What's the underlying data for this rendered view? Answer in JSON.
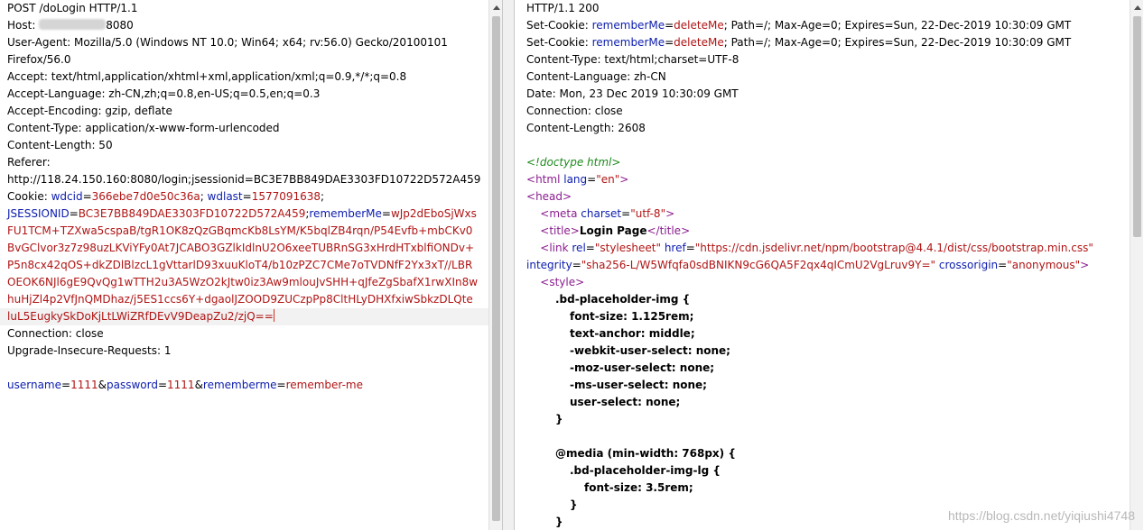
{
  "request": {
    "line1": "POST /doLogin HTTP/1.1",
    "host_label": "Host: ",
    "host_port": "8080",
    "ua1": "User-Agent: Mozilla/5.0 (Windows NT 10.0; Win64; x64; rv:56.0) Gecko/20100101",
    "ua2": "Firefox/56.0",
    "accept": "Accept: text/html,application/xhtml+xml,application/xml;q=0.9,*/*;q=0.8",
    "accept_language": "Accept-Language: zh-CN,zh;q=0.8,en-US;q=0.5,en;q=0.3",
    "accept_encoding": "Accept-Encoding: gzip, deflate",
    "content_type": "Content-Type: application/x-www-form-urlencoded",
    "content_length": "Content-Length: 50",
    "referer_label": "Referer:",
    "referer_url": "http://118.24.150.160:8080/login;jsessionid=BC3E7BB849DAE3303FD10722D572A459",
    "cookie_label": "Cookie: ",
    "cookie_k1": "wdcid",
    "cookie_v1": "366ebe7d0e50c36a",
    "cookie_k2": "wdlast",
    "cookie_v2": "1577091638",
    "cookie_k3": "JSESSIONID",
    "cookie_v3": "BC3E7BB849DAE3303FD10722D572A459",
    "cookie_k4": "rememberMe",
    "cookie_v4_l1": "wJp2dEboSjWxs",
    "cookie_v4_l2": "FU1TCM+TZXwa5cspaB/tgR1OK8zQzGBqmcKb8LsYM/K5bqlZB4rqn/P54Evfb+mbCKv0",
    "cookie_v4_l3": "BvGClvor3z7z98uzLKViYFy0At7JCABO3GZlkIdlnU2O6xeeTUBRnSG3xHrdHTxblfiONDv+",
    "cookie_v4_l4": "P5n8cx42qOS+dkZDlBlzcL1gVttarlD93xuuKloT4/b10zPZC7CMe7oTVDNfF2Yx3xT//LBR",
    "cookie_v4_l5": "OEOK6NJl6gE9QvQg1wTTH2u3A5WzO2kJtw0iz3Aw9mlouJvSHH+qJfeZgSbafX1rwXIn8w",
    "cookie_v4_l6": "huHjZl4p2VfJnQMDhaz/j5ES1ccs6Y+dgaolJZOOD9ZUCzpPp8CltHLyDHXfxiwSbkzDLQte",
    "cookie_v4_l7": "luL5EugkySkDoKjLtLWiZRfDEvV9DeapZu2/zjQ==",
    "connection": "Connection: close",
    "upgrade": "Upgrade-Insecure-Requests: 1",
    "body_k1": "username",
    "body_v1": "1111",
    "body_k2": "password",
    "body_v2": "1111",
    "body_k3": "rememberme",
    "body_v3": "remember-me"
  },
  "response": {
    "status": "HTTP/1.1 200",
    "setcookie_label": "Set-Cookie: ",
    "setcookie_key": "rememberMe",
    "setcookie_val": "deleteMe",
    "setcookie_rest": "; Path=/; Max-Age=0; Expires=Sun, 22-Dec-2019 10:30:09 GMT",
    "content_type": "Content-Type: text/html;charset=UTF-8",
    "content_language": "Content-Language: zh-CN",
    "date": "Date: Mon, 23 Dec 2019 10:30:09 GMT",
    "connection": "Connection: close",
    "content_length": "Content-Length: 2608",
    "doctype": "<!doctype html>",
    "html_tag": "html",
    "html_attr": "lang",
    "html_val": "\"en\"",
    "head_tag": "head",
    "meta_tag": "meta",
    "meta_attr": "charset",
    "meta_val": "\"utf-8\"",
    "title_tag": "title",
    "title_text": "Login Page",
    "link_tag": "link",
    "link_rel_attr": "rel",
    "link_rel_val": "\"stylesheet\"",
    "link_href_attr": "href",
    "link_href_val": "\"https://cdn.jsdelivr.net/npm/bootstrap@4.4.1/dist/css/bootstrap.min.css\"",
    "integrity_attr": "integrity",
    "integrity_val": "\"sha256-L/W5Wfqfa0sdBNIKN9cG6QA5F2qx4qICmU2VgLruv9Y=\"",
    "crossorigin_attr": "crossorigin",
    "crossorigin_val": "\"anonymous\"",
    "style_tag": "style",
    "css1": ".bd-placeholder-img {",
    "css2": "font-size: 1.125rem;",
    "css3": "text-anchor: middle;",
    "css4": "-webkit-user-select: none;",
    "css5": "-moz-user-select: none;",
    "css6": "-ms-user-select: none;",
    "css7": "user-select: none;",
    "css8": "}",
    "css9": "@media (min-width: 768px) {",
    "css10": ".bd-placeholder-img-lg {",
    "css11": "font-size: 3.5rem;",
    "css12": "}",
    "css13": "}"
  },
  "watermark": "https://blog.csdn.net/yiqiushi4748"
}
